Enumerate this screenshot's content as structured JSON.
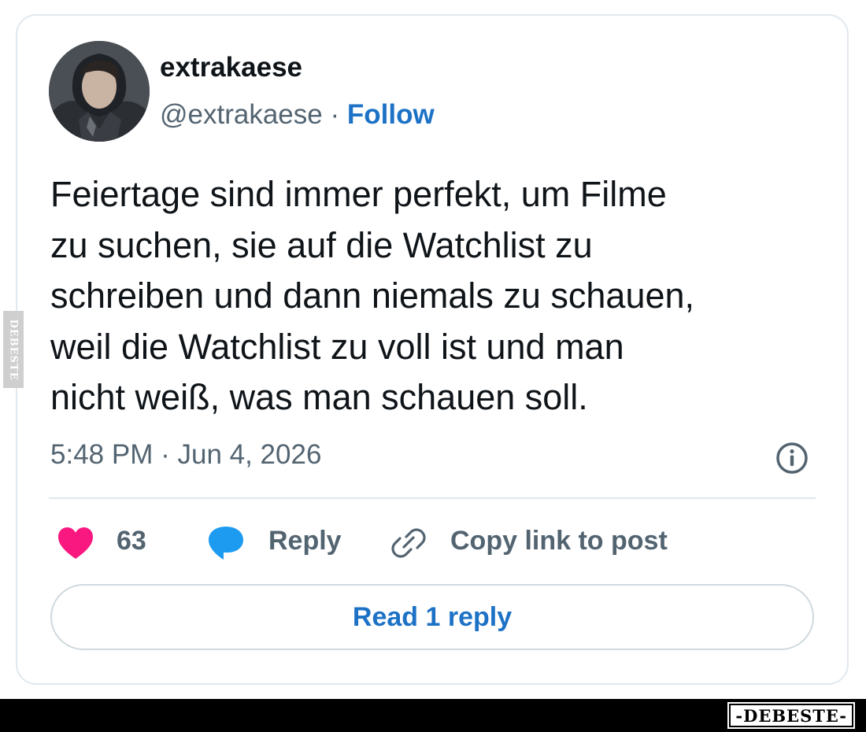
{
  "author": {
    "display_name": "extrakaese",
    "handle": "@extrakaese",
    "separator": "·",
    "follow_label": "Follow"
  },
  "tweet": {
    "lines": [
      "Feiertage sind immer perfekt, um Filme",
      "zu suchen, sie auf die Watchlist zu",
      "schreiben und dann niemals zu schauen,",
      "weil die Watchlist zu voll ist und man",
      "nicht weiß, was man schauen soll."
    ],
    "time": "5:48 PM",
    "date_separator": "·",
    "date": "Jun 4, 2026"
  },
  "actions": {
    "likes_count": "63",
    "reply_label": "Reply",
    "copy_link_label": "Copy link to post"
  },
  "read_reply_label": "Read 1 reply",
  "watermark": {
    "side_text": "DEBESTE",
    "bottom_text": "-DEBESTE-"
  },
  "icons": {
    "like": "heart-icon",
    "reply": "speech-bubble-icon",
    "copy": "link-icon",
    "info": "info-icon"
  },
  "colors": {
    "link_blue": "#1d72c6",
    "heart_pink": "#f91880",
    "reply_blue": "#1d9bf0",
    "muted": "#536471"
  }
}
